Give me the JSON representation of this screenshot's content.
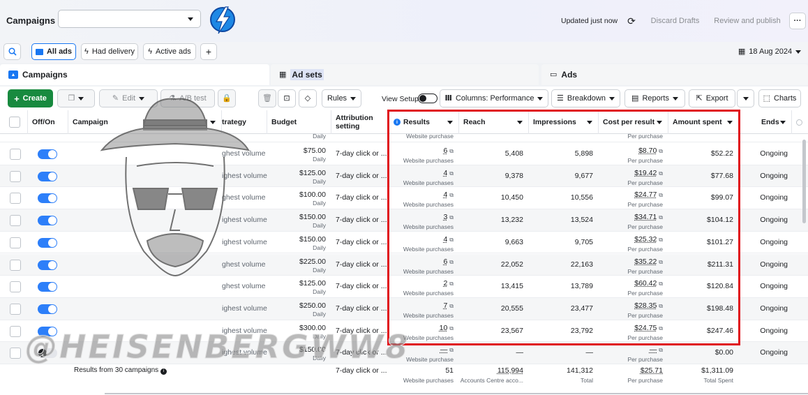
{
  "header": {
    "title": "Campaigns",
    "campaign_select_value": "",
    "updated": "Updated just now",
    "discard": "Discard Drafts",
    "review": "Review and publish",
    "more": "···"
  },
  "filters": {
    "all_ads": "All ads",
    "had_delivery": "Had delivery",
    "active_ads": "Active ads",
    "add": "+",
    "date": "18 Aug 2024"
  },
  "tabs": [
    {
      "label": "Campaigns"
    },
    {
      "label": "Ad sets"
    },
    {
      "label": "Ads"
    }
  ],
  "toolbar": {
    "create": "Create",
    "edit": "Edit",
    "ab_test": "A/B test",
    "rules": "Rules",
    "view_setup": "View Setup",
    "columns": "Columns: Performance",
    "breakdown": "Breakdown",
    "reports": "Reports",
    "export": "Export",
    "charts": "Charts"
  },
  "columns": {
    "off_on": "Off/On",
    "campaign": "Campaign",
    "strategy": "trategy",
    "budget": "Budget",
    "attribution": "Attribution setting",
    "results": "Results",
    "reach": "Reach",
    "impressions": "Impressions",
    "cost": "Cost per result",
    "amount": "Amount spent",
    "ends": "Ends"
  },
  "top_partial": {
    "budget_sub": "Daily",
    "results_sub": "Website purchase",
    "cost_sub": "Per purchase"
  },
  "rows": [
    {
      "strategy": "ghest volume",
      "budget": "$75.00",
      "budget_sub": "Daily",
      "attr": "7-day click or ...",
      "result": "6",
      "result_sub": "Website purchases",
      "reach": "5,408",
      "impr": "5,898",
      "cost": "$8.70",
      "cost_sub": "Per purchase",
      "amount": "$52.22",
      "ends": "Ongoing",
      "on": true
    },
    {
      "strategy": "ighest volume",
      "budget": "$125.00",
      "budget_sub": "Daily",
      "attr": "7-day click or ...",
      "result": "4",
      "result_sub": "Website purchases",
      "reach": "9,378",
      "impr": "9,677",
      "cost": "$19.42",
      "cost_sub": "Per purchase",
      "amount": "$77.68",
      "ends": "Ongoing",
      "on": true
    },
    {
      "strategy": "ghest volume",
      "budget": "$100.00",
      "budget_sub": "Daily",
      "attr": "7-day click or ...",
      "result": "4",
      "result_sub": "Website purchases",
      "reach": "10,450",
      "impr": "10,556",
      "cost": "$24.77",
      "cost_sub": "Per purchase",
      "amount": "$99.07",
      "ends": "Ongoing",
      "on": true
    },
    {
      "strategy": "ighest volume",
      "budget": "$150.00",
      "budget_sub": "Daily",
      "attr": "7-day click or ...",
      "result": "3",
      "result_sub": "Website purchases",
      "reach": "13,232",
      "impr": "13,524",
      "cost": "$34.71",
      "cost_sub": "Per purchase",
      "amount": "$104.12",
      "ends": "Ongoing",
      "on": true
    },
    {
      "strategy": "ighest volume",
      "budget": "$150.00",
      "budget_sub": "Daily",
      "attr": "7-day click or ...",
      "result": "4",
      "result_sub": "Website purchases",
      "reach": "9,663",
      "impr": "9,705",
      "cost": "$25.32",
      "cost_sub": "Per purchase",
      "amount": "$101.27",
      "ends": "Ongoing",
      "on": true
    },
    {
      "strategy": "ghest volume",
      "budget": "$225.00",
      "budget_sub": "Daily",
      "attr": "7-day click or ...",
      "result": "6",
      "result_sub": "Website purchases",
      "reach": "22,052",
      "impr": "22,163",
      "cost": "$35.22",
      "cost_sub": "Per purchase",
      "amount": "$211.31",
      "ends": "Ongoing",
      "on": true
    },
    {
      "strategy": "ghest volume",
      "budget": "$125.00",
      "budget_sub": "Daily",
      "attr": "7-day click or ...",
      "result": "2",
      "result_sub": "Website purchases",
      "reach": "13,415",
      "impr": "13,789",
      "cost": "$60.42",
      "cost_sub": "Per purchase",
      "amount": "$120.84",
      "ends": "Ongoing",
      "on": true
    },
    {
      "strategy": "ighest volume",
      "budget": "$250.00",
      "budget_sub": "Daily",
      "attr": "7-day click or ...",
      "result": "7",
      "result_sub": "Website purchases",
      "reach": "20,555",
      "impr": "23,477",
      "cost": "$28.35",
      "cost_sub": "Per purchase",
      "amount": "$198.48",
      "ends": "Ongoing",
      "on": true
    },
    {
      "strategy": "ighest volume",
      "budget": "$300.00",
      "budget_sub": "Daily",
      "attr": "7-day click or ...",
      "result": "10",
      "result_sub": "Website purchases",
      "reach": "23,567",
      "impr": "23,792",
      "cost": "$24.75",
      "cost_sub": "Per purchase",
      "amount": "$247.46",
      "ends": "Ongoing",
      "on": true
    },
    {
      "strategy": "ighest volume",
      "budget": "$150.00",
      "budget_sub": "Daily",
      "attr": "7-day click or ...",
      "result": "—",
      "result_sub": "Website purchase",
      "reach": "—",
      "impr": "—",
      "cost": "—",
      "cost_sub": "Per purchase",
      "amount": "$0.00",
      "ends": "Ongoing",
      "on": false
    }
  ],
  "totals": {
    "label": "Results from 30 campaigns",
    "attr": "7-day click or ...",
    "result": "51",
    "result_sub": "Website purchases",
    "reach": "115,994",
    "reach_sub": "Accounts Centre acco...",
    "impr": "141,312",
    "impr_sub": "Total",
    "cost": "$25.71",
    "cost_sub": "Per purchase",
    "amount": "$1,311.09",
    "amount_sub": "Total Spent"
  },
  "watermark": "@HEISENBERGWW8",
  "colors": {
    "accent": "#1877f2",
    "create": "#188a3f",
    "highlight": "#e0121b",
    "logo": "#1e88e5"
  }
}
